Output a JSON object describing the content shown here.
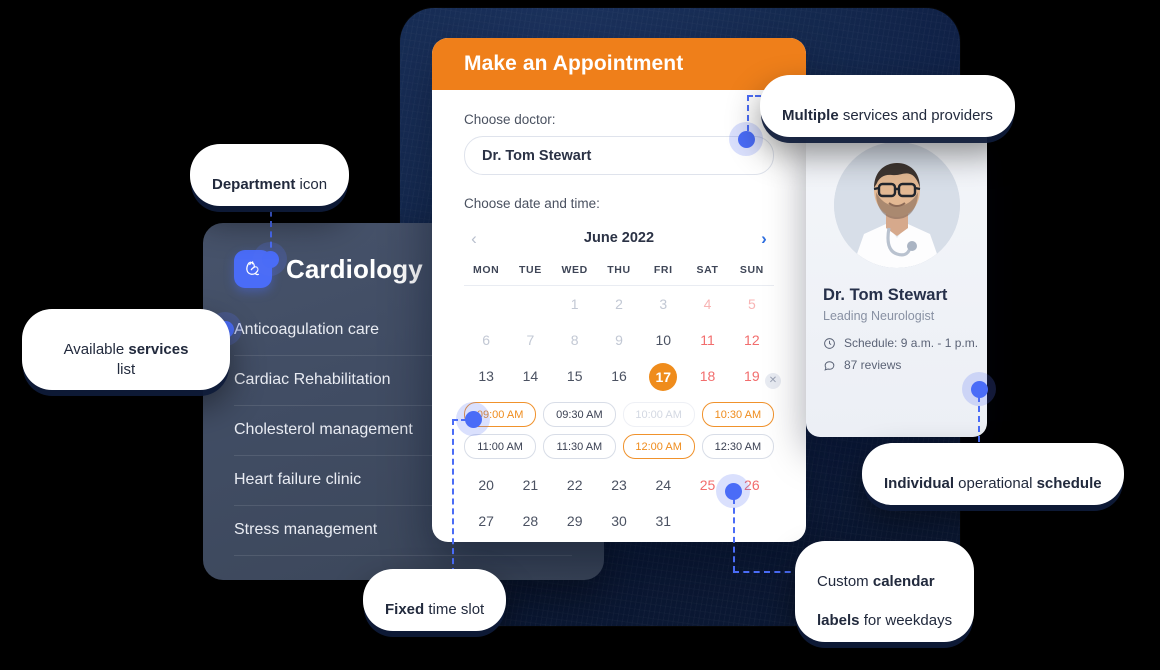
{
  "department": {
    "title": "Cardiology",
    "icon": "heart-anatomy-icon",
    "services": [
      "Anticoagulation care",
      "Cardiac Rehabilitation",
      "Cholesterol management",
      "Heart failure clinic",
      "Stress management"
    ]
  },
  "appointment": {
    "header_title": "Make an Appointment",
    "doctor_label": "Choose doctor:",
    "doctor_value": "Dr. Tom Stewart",
    "datetime_label": "Choose date and time:",
    "calendar": {
      "month": "June 2022",
      "prev_icon": "chevron-left-icon",
      "next_icon": "chevron-right-icon",
      "weekday_labels": [
        "MON",
        "TUE",
        "WED",
        "THU",
        "FRI",
        "SAT",
        "SUN"
      ],
      "lead_blanks": 2,
      "weeks_top": [
        [
          {
            "d": "",
            "type": "empty"
          },
          {
            "d": "",
            "type": "empty"
          },
          {
            "d": "1",
            "type": "muted"
          },
          {
            "d": "2",
            "type": "muted"
          },
          {
            "d": "3",
            "type": "muted"
          },
          {
            "d": "4",
            "type": "weekend-muted"
          },
          {
            "d": "5",
            "type": "weekend-muted"
          }
        ],
        [
          {
            "d": "6",
            "type": "muted"
          },
          {
            "d": "7",
            "type": "muted"
          },
          {
            "d": "8",
            "type": "muted"
          },
          {
            "d": "9",
            "type": "muted"
          },
          {
            "d": "10",
            "type": "normal"
          },
          {
            "d": "11",
            "type": "weekend"
          },
          {
            "d": "12",
            "type": "weekend"
          }
        ],
        [
          {
            "d": "13",
            "type": "normal"
          },
          {
            "d": "14",
            "type": "normal"
          },
          {
            "d": "15",
            "type": "normal"
          },
          {
            "d": "16",
            "type": "normal"
          },
          {
            "d": "17",
            "type": "today"
          },
          {
            "d": "18",
            "type": "weekend"
          },
          {
            "d": "19",
            "type": "weekend"
          }
        ]
      ],
      "weeks_bottom": [
        [
          {
            "d": "20",
            "type": "normal"
          },
          {
            "d": "21",
            "type": "normal"
          },
          {
            "d": "22",
            "type": "normal"
          },
          {
            "d": "23",
            "type": "normal"
          },
          {
            "d": "24",
            "type": "normal"
          },
          {
            "d": "25",
            "type": "weekend"
          },
          {
            "d": "26",
            "type": "weekend"
          }
        ],
        [
          {
            "d": "27",
            "type": "normal"
          },
          {
            "d": "28",
            "type": "normal"
          },
          {
            "d": "29",
            "type": "normal"
          },
          {
            "d": "30",
            "type": "normal"
          },
          {
            "d": "31",
            "type": "normal"
          },
          {
            "d": "",
            "type": "empty"
          },
          {
            "d": "",
            "type": "empty"
          }
        ]
      ],
      "selected_day": "17"
    },
    "time_slots": [
      {
        "label": "09:00 AM",
        "state": "selected"
      },
      {
        "label": "09:30 AM",
        "state": "available"
      },
      {
        "label": "10:00 AM",
        "state": "disabled"
      },
      {
        "label": "10:30 AM",
        "state": "selected"
      },
      {
        "label": "11:00 AM",
        "state": "available"
      },
      {
        "label": "11:30 AM",
        "state": "available"
      },
      {
        "label": "12:00 AM",
        "state": "selected"
      },
      {
        "label": "12:30 AM",
        "state": "available"
      }
    ],
    "close_icon": "close-icon"
  },
  "doctor_card": {
    "name": "Dr. Tom Stewart",
    "role": "Leading Neurologist",
    "schedule_icon": "clock-icon",
    "schedule": "Schedule: 9 a.m. - 1 p.m.",
    "reviews_icon": "comment-icon",
    "reviews": "87 reviews"
  },
  "callouts": {
    "department_icon": {
      "strong": "Department",
      "rest": " icon"
    },
    "services_list": {
      "strong": "Available ",
      "bold": "services",
      "rest": "\nlist"
    },
    "multiple_services": {
      "strong": "Multiple",
      "rest": " services and providers"
    },
    "individual_schedule": {
      "a": "Individual",
      "b": " operational ",
      "c": "schedule"
    },
    "fixed_slot": {
      "strong": "Fixed",
      "rest": " time slot"
    },
    "calendar_labels": {
      "a": "Custom ",
      "b": "calendar",
      "c": "\n",
      "d": "labels",
      "e": " for weekdays"
    }
  },
  "colors": {
    "accent_orange": "#ef7f1a",
    "accent_blue": "#4a6cf7",
    "panel_dark": "#414d64",
    "backdrop_navy": "#152a50",
    "weekend_red": "#f26d6d"
  }
}
